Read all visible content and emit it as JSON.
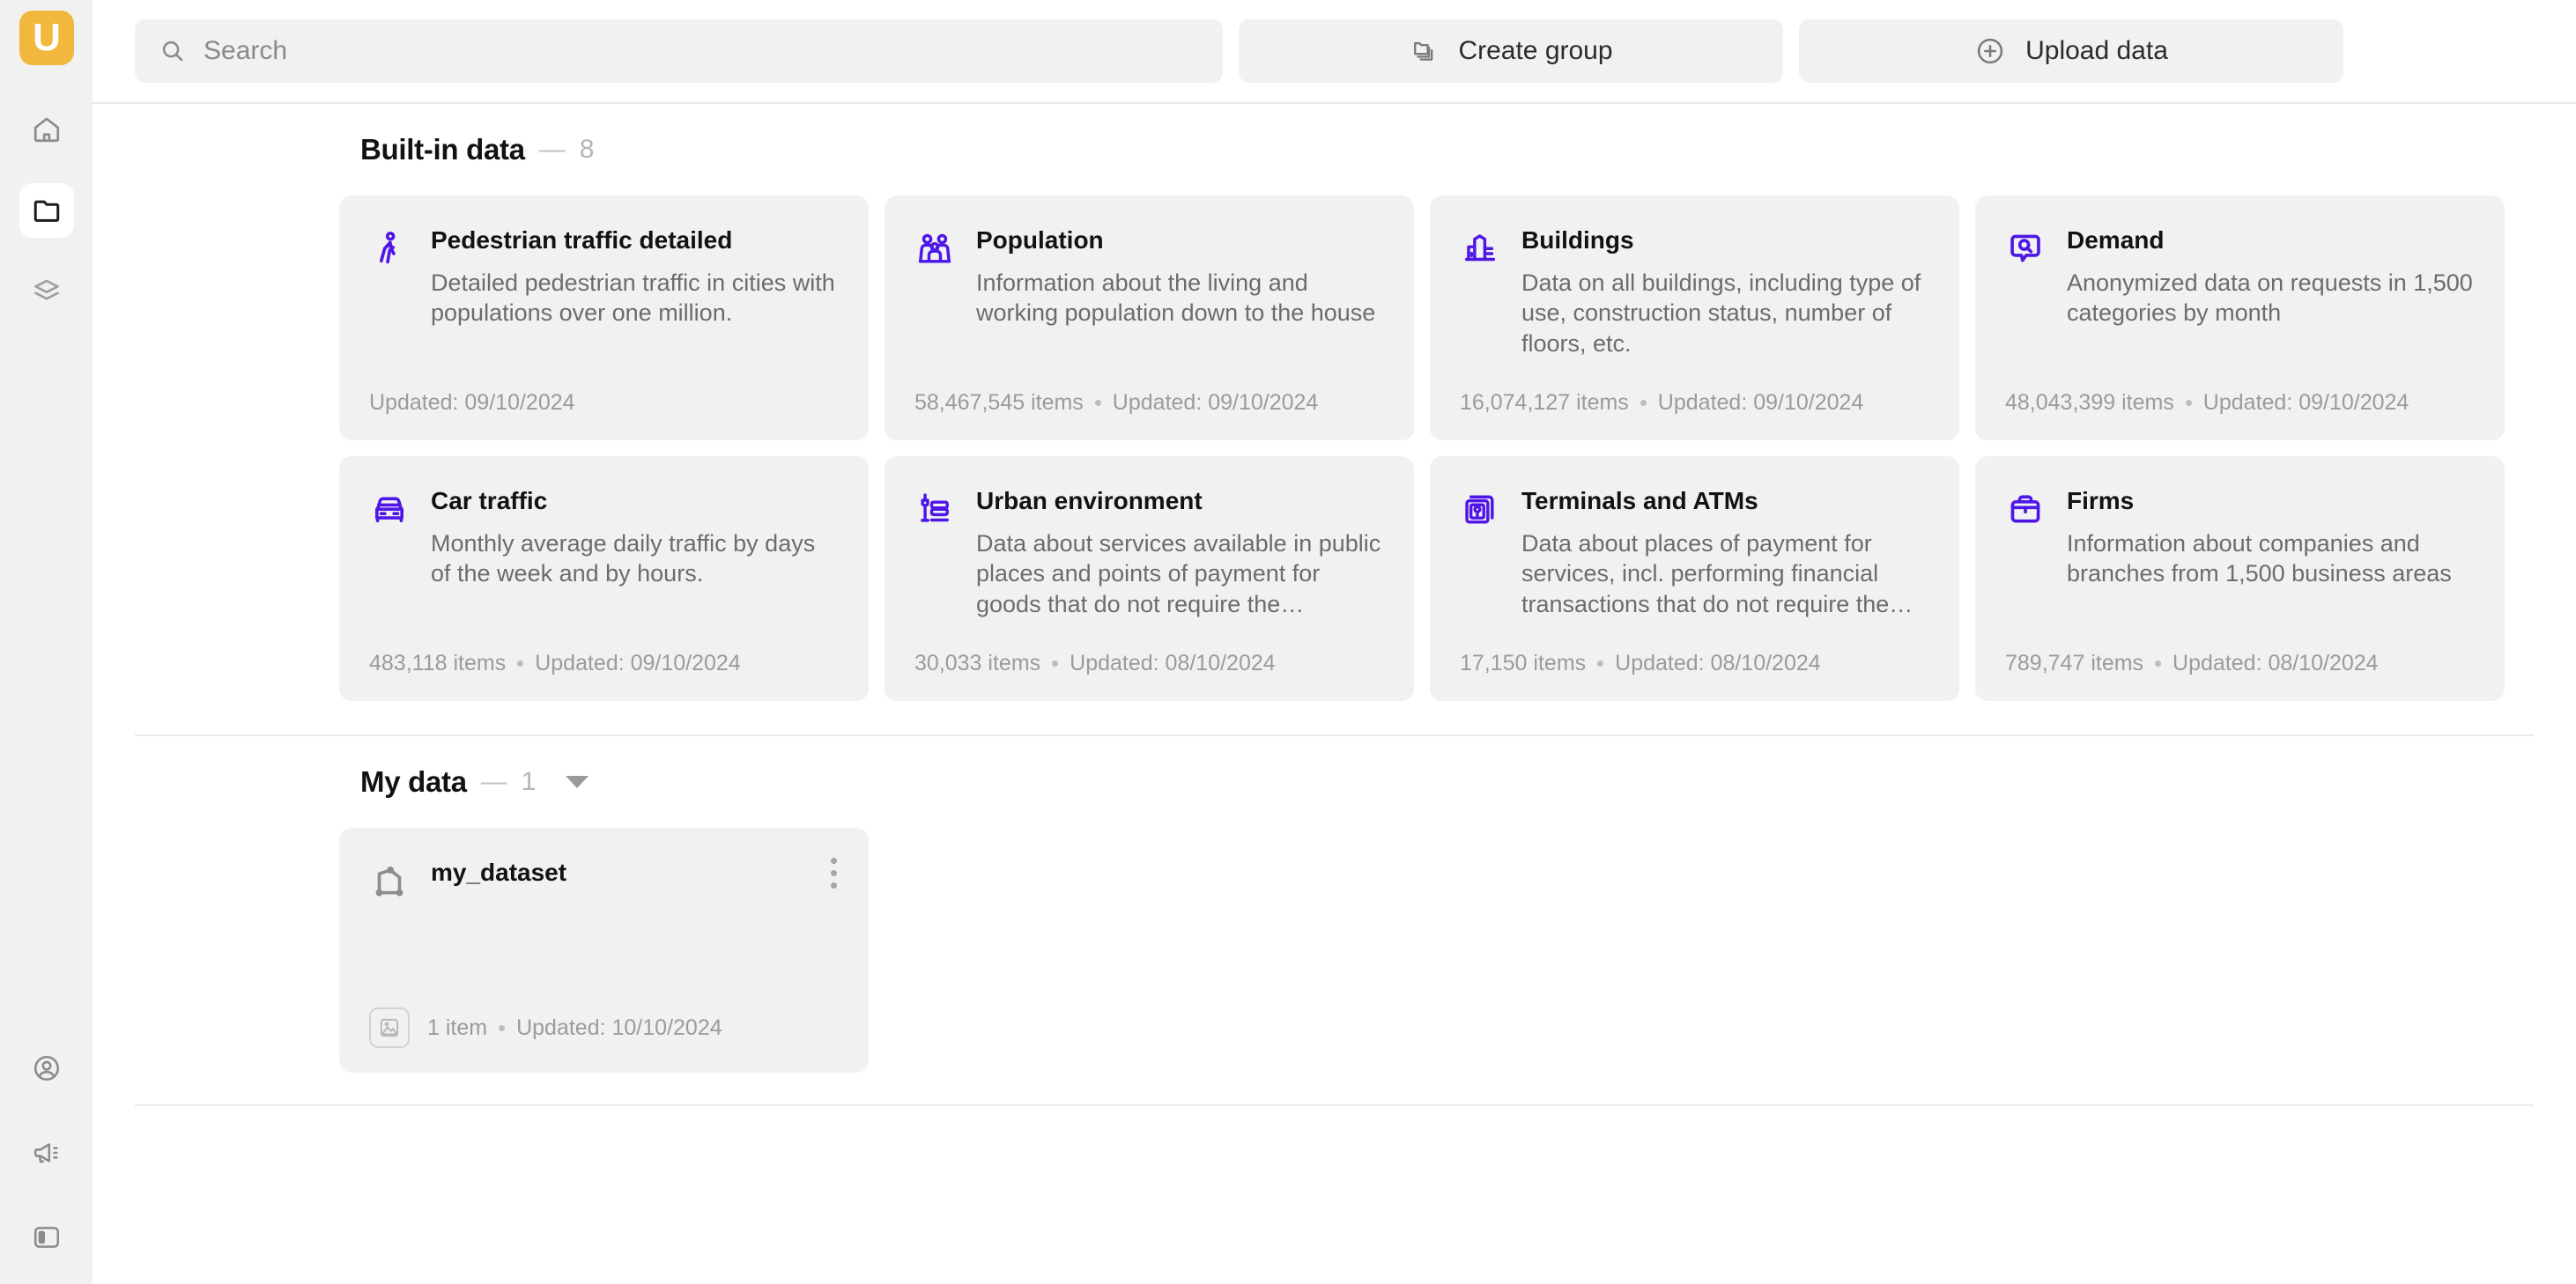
{
  "brand": {
    "logo_letter": "U",
    "logo_color": "#f2b73d",
    "accent_color": "#4f16e8"
  },
  "sidebar": {
    "top_items": [
      {
        "name": "home",
        "icon": "home-icon",
        "active": false
      },
      {
        "name": "data",
        "icon": "folder-icon",
        "active": true
      },
      {
        "name": "layers",
        "icon": "layers-icon",
        "active": false
      }
    ],
    "bottom_items": [
      {
        "name": "account",
        "icon": "user-circle-icon"
      },
      {
        "name": "announcements",
        "icon": "megaphone-icon"
      },
      {
        "name": "panel-toggle",
        "icon": "panel-toggle-icon"
      }
    ]
  },
  "toolbar": {
    "search_placeholder": "Search",
    "search_value": "",
    "create_group_label": "Create group",
    "upload_data_label": "Upload data"
  },
  "builtin_section": {
    "title": "Built-in data",
    "dash": "—",
    "count": "8",
    "cards": [
      {
        "icon": "pedestrian-icon",
        "title": "Pedestrian traffic detailed",
        "description": "Detailed pedestrian traffic in cities with populations over one million.",
        "items": "",
        "updated": "Updated: 09/10/2024"
      },
      {
        "icon": "population-icon",
        "title": "Population",
        "description": "Information about the living and working population down to the house",
        "items": "58,467,545 items",
        "updated": "Updated: 09/10/2024"
      },
      {
        "icon": "buildings-icon",
        "title": "Buildings",
        "description": "Data on all buildings, including type of use, construction status, number of floors, etc.",
        "items": "16,074,127 items",
        "updated": "Updated: 09/10/2024"
      },
      {
        "icon": "demand-icon",
        "title": "Demand",
        "description": "Anonymized data on requests in 1,500 categories by month",
        "items": "48,043,399 items",
        "updated": "Updated: 09/10/2024"
      },
      {
        "icon": "car-icon",
        "title": "Car traffic",
        "description": "Monthly average daily traffic by days of the week and by hours.",
        "items": "483,118 items",
        "updated": "Updated: 09/10/2024"
      },
      {
        "icon": "urban-environment-icon",
        "title": "Urban environment",
        "description": "Data about services available in public places and points of payment for goods that do not require the…",
        "items": "30,033 items",
        "updated": "Updated: 08/10/2024"
      },
      {
        "icon": "atm-icon",
        "title": "Terminals and ATMs",
        "description": "Data about places of payment for services, incl. performing financial transactions that do not require the…",
        "items": "17,150 items",
        "updated": "Updated: 08/10/2024"
      },
      {
        "icon": "briefcase-icon",
        "title": "Firms",
        "description": "Information about companies and branches from 1,500 business areas",
        "items": "789,747 items",
        "updated": "Updated: 08/10/2024"
      }
    ]
  },
  "mydata_section": {
    "title": "My data",
    "dash": "—",
    "count": "1",
    "cards": [
      {
        "icon": "polygon-file-icon",
        "title": "my_dataset",
        "items": "1 item",
        "updated": "Updated: 10/10/2024",
        "badge_icon": "dataset-thumb-icon"
      }
    ]
  }
}
